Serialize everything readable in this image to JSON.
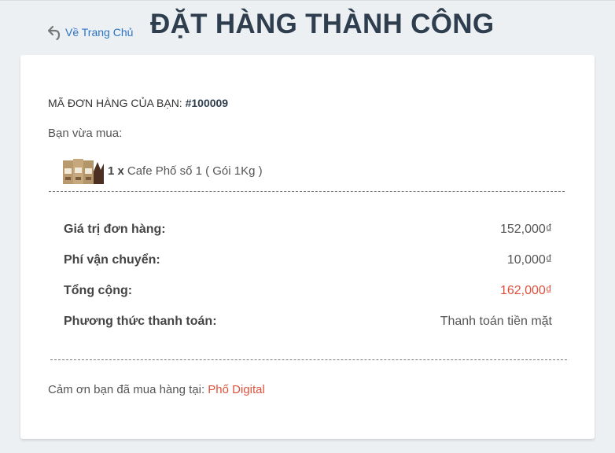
{
  "header": {
    "back_label": "Về Trang Chủ",
    "title": "ĐẶT HÀNG THÀNH CÔNG"
  },
  "order": {
    "code_label": "MÃ ĐƠN HÀNG CỦA BẠN:",
    "code_value": "#100009",
    "bought_label": "Bạn vừa mua:",
    "item": {
      "quantity": "1 x",
      "name": "Cafe Phố số 1 ( Gói 1Kg )"
    }
  },
  "summary": {
    "rows": [
      {
        "label": "Giá trị đơn hàng:",
        "value": "152,000₫"
      },
      {
        "label": "Phí vận chuyển:",
        "value": "10,000₫"
      },
      {
        "label": "Tổng cộng:",
        "value": "162,000₫"
      },
      {
        "label": "Phương thức thanh toán:",
        "value": "Thanh toán tiền mặt"
      }
    ]
  },
  "footer": {
    "thanks_label": "Cảm ơn bạn đã mua hàng tại:",
    "store_name": "Phố Digital"
  },
  "colors": {
    "title": "#2f3e4e",
    "link": "#2a73c4",
    "accent": "#e0513d",
    "background": "#edf0f3"
  }
}
